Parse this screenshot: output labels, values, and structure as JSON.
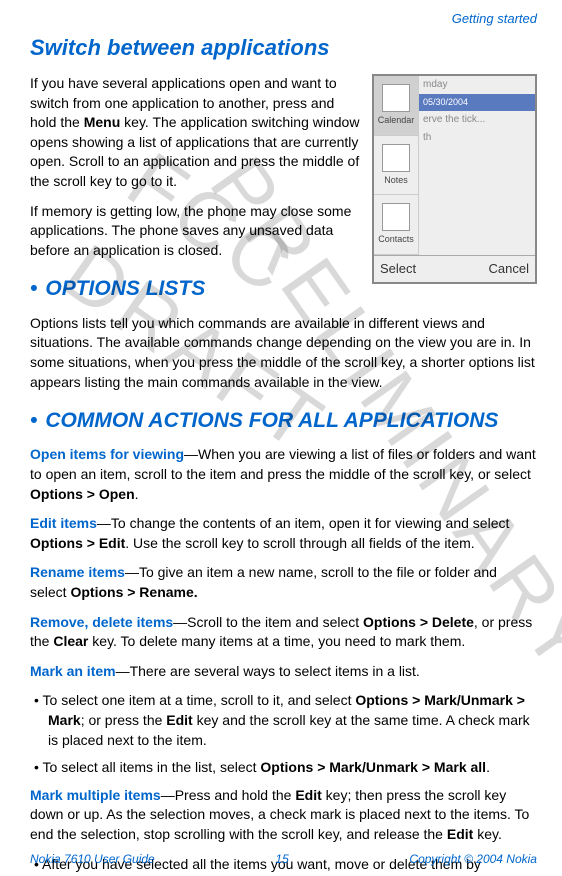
{
  "header": {
    "section": "Getting started"
  },
  "watermarks": {
    "w1": "FCC DRAFT",
    "w2": "PRELIMINARY"
  },
  "h1": "Switch between applications",
  "p1a": "If you have several applications open and want to switch from one application to another, press and hold the ",
  "p1b": "Menu",
  "p1c": " key. The application switching window opens showing a list of applications that are currently open. Scroll to an application and press the middle of the scroll key to go to it.",
  "p2": "If memory is getting low, the phone may close some applications. The phone saves any unsaved data before an application is closed.",
  "h2a_bullet": "•",
  "h2a": "OPTIONS LISTS",
  "p3": "Options lists tell you which commands are available in different views and situations. The available commands change depending on the view you are in. In some situations, when you press the middle of the scroll key, a shorter options list appears listing the main commands available in the view.",
  "h2b_bullet": "•",
  "h2b": "COMMON ACTIONS FOR ALL APPLICATIONS",
  "p4_label": "Open items for viewing",
  "p4_text": "—When you are viewing a list of files or folders and want to open an item, scroll to the item and press the middle of the scroll key, or select ",
  "p4_bold": "Options > Open",
  "p4_end": ".",
  "p5_label": "Edit items",
  "p5_text": "—To change the contents of an item, open it for viewing and select ",
  "p5_bold": "Options > Edit",
  "p5_end": ". Use the scroll key to scroll through all fields of the item.",
  "p6_label": "Rename items",
  "p6_text": "—To give an item a new name, scroll to the file or folder and select ",
  "p6_bold": "Options > Rename.",
  "p7_label": "Remove, delete items",
  "p7_text": "—Scroll to the item and select ",
  "p7_bold1": "Options > Delete",
  "p7_mid": ", or press the ",
  "p7_bold2": "Clear",
  "p7_end": " key. To delete many items at a time, you need to mark them.",
  "p8_label": "Mark an item",
  "p8_text": "—There are several ways to select items in a list.",
  "li1a": "To select one item at a time, scroll to it, and select ",
  "li1_bold1": "Options > Mark/Unmark > Mark",
  "li1b": "; or press the ",
  "li1_bold2": "Edit",
  "li1c": " key and the scroll key at the same time. A check mark is placed next to the item.",
  "li2a": "To select all items in the list, select ",
  "li2_bold": "Options > Mark/Unmark > Mark all",
  "li2b": ".",
  "p9_label": "Mark multiple items",
  "p9_text": "—Press and hold the ",
  "p9_bold1": "Edit",
  "p9_mid1": " key; then press the scroll key down or up. As the selection moves, a check mark is placed next to the items. To end the selection, stop scrolling with the scroll key, and release the ",
  "p9_bold2": "Edit",
  "p9_end": " key.",
  "li3": "After you have selected all the items you want, move or delete them by",
  "footer": {
    "left": "Nokia 7610 User Guide",
    "center": "15",
    "right": "Copyright © 2004 Nokia"
  },
  "screenshot": {
    "icons": {
      "calendar": "Calendar",
      "notes": "Notes",
      "contacts": "Contacts"
    },
    "right": {
      "day": "mday",
      "date": "05/30/2004",
      "note": "erve the tick...",
      "note2": "th"
    },
    "softkeys": {
      "left": "Select",
      "right": "Cancel"
    }
  }
}
